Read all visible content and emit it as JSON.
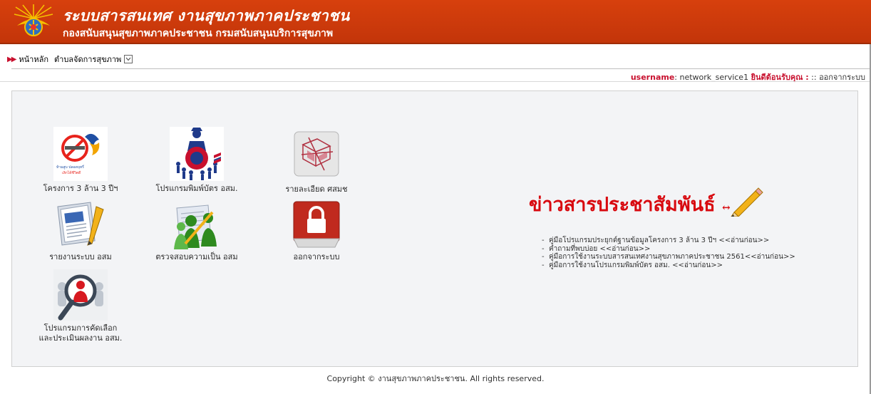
{
  "header": {
    "title": "ระบบสารสนเทศ งานสุขภาพภาคประชาชน",
    "subtitle": "กองสนับสนุนสุขภาพภาคประชาชน กรมสนับสนุนบริการสุขภาพ",
    "logo_icon": "ministry-of-public-health-emblem",
    "colors": {
      "banner": "#c93a0b",
      "text": "#ffffff"
    }
  },
  "nav": {
    "home_label": "หน้าหลัก",
    "submenu_label": "ตำบลจัดการสุขภาพ"
  },
  "userbar": {
    "username_key": "username",
    "username_value": "network_service1",
    "welcome": "ยินดีต้อนรับคุณ :",
    "separator": "::",
    "logout": "ออกจากระบบ"
  },
  "menu": [
    {
      "label": "โครงการ 3 ล้าน 3 ปีฯ",
      "icon": "no-smoking-project-logo-icon"
    },
    {
      "label": "โปรแกรมพิมพ์บัตร อสม.",
      "icon": "volunteer-group-icon"
    },
    {
      "label": "รายละเอียด ศสมช",
      "icon": "details-report-icon"
    },
    {
      "label": "รายงานระบบ อสม",
      "icon": "newspaper-report-icon"
    },
    {
      "label": "ตรวจสอบความเป็น อสม",
      "icon": "people-check-icon"
    },
    {
      "label": "ออกจากระบบ",
      "icon": "padlock-icon"
    },
    {
      "label_line1": "โปรแกรมการคัดเลือก",
      "label_line2": "และประเมินผลงาน อสม.",
      "icon": "magnifier-person-icon"
    }
  ],
  "news": {
    "title": "ข่าวสารประชาสัมพันธ์",
    "arrow": "↔",
    "icon": "pencil-icon",
    "items": [
      {
        "text": "คู่มือโปรแกรมประยุกต์ฐานข้อมูลโครงการ 3 ล้าน 3 ปีฯ ",
        "more": "<<อ่านก่อน>>"
      },
      {
        "text": "คำถามที่พบบ่อย ",
        "more": "<<อ่านก่อน>>"
      },
      {
        "text": "คู่มือการใช้งานระบบสารสนเทศงานสุขภาพภาคประชาชน 2561",
        "more": "<<อ่านก่อน>>"
      },
      {
        "text": "คู่มือการใช้งานโปรแกรมพิมพ์บัตร อสม. ",
        "more": "<<อ่านก่อน>>"
      }
    ]
  },
  "footer": {
    "copyright": "Copyright © งานสุขภาพภาคประชาชน. All rights reserved."
  }
}
